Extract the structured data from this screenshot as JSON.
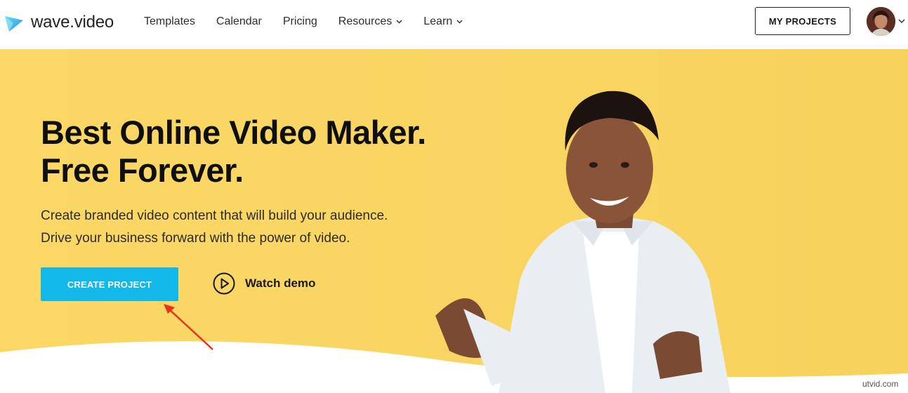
{
  "header": {
    "logo_text": "wave.video",
    "nav": [
      {
        "label": "Templates",
        "dropdown": false
      },
      {
        "label": "Calendar",
        "dropdown": false
      },
      {
        "label": "Pricing",
        "dropdown": false
      },
      {
        "label": "Resources",
        "dropdown": true
      },
      {
        "label": "Learn",
        "dropdown": true
      }
    ],
    "my_projects_label": "MY PROJECTS"
  },
  "hero": {
    "headline_line1": "Best Online Video Maker.",
    "headline_line2": "Free Forever.",
    "sub_line1": "Create branded video content that will build your audience.",
    "sub_line2": "Drive your business forward with the power of video.",
    "cta_label": "CREATE PROJECT",
    "demo_label": "Watch demo"
  },
  "watermark": "utvid.com",
  "colors": {
    "hero_background": "#f9d56a",
    "cta": "#12b8e8",
    "annotation_arrow": "#e8321e",
    "logo_gradient": [
      "#3fd0ea",
      "#2f8fe0"
    ]
  },
  "icons": [
    "logo-icon",
    "chevron-down-icon",
    "play-circle-icon",
    "avatar",
    "annotation-arrow"
  ]
}
